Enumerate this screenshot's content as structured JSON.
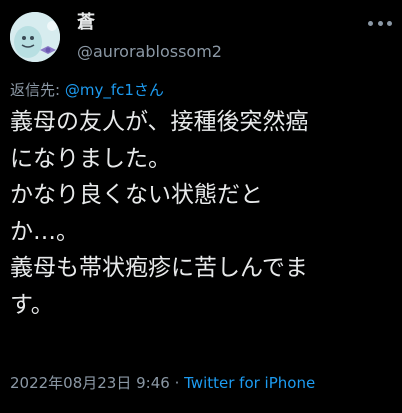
{
  "author": {
    "display_name": "蒼",
    "handle": "@aurorablossom2"
  },
  "reply": {
    "prefix": "返信先: ",
    "mention": "@my_fc1さん"
  },
  "body": {
    "lines": [
      "義母の友人が、接種後突然癌",
      "になりました。",
      "かなり良くない状態だと",
      "か…。",
      "義母も帯状疱疹に苦しんでま",
      "す。"
    ]
  },
  "meta": {
    "datetime": "2022年08月23日 9:46",
    "separator": " · ",
    "source": "Twitter for iPhone"
  },
  "colors": {
    "background": "#000000",
    "text": "#e7e9ea",
    "secondary": "#8b98a5",
    "link": "#1d9bf0"
  },
  "icons": [
    "avatar-image",
    "more-options-icon"
  ]
}
